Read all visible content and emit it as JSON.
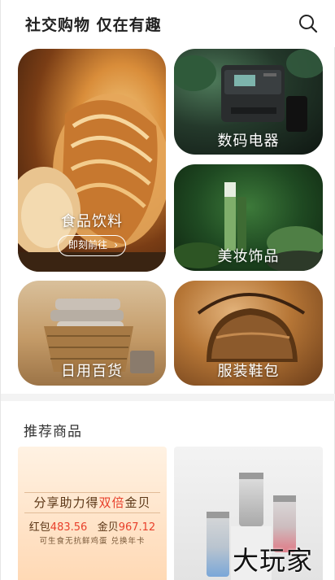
{
  "header": {
    "title": "社交购物 仅在有趣",
    "search_icon": "search-icon"
  },
  "categories": {
    "food": {
      "label": "食品饮料",
      "button": "即刻前往"
    },
    "digital": {
      "label": "数码电器"
    },
    "beauty": {
      "label": "美妆饰品"
    },
    "daily": {
      "label": "日用百货"
    },
    "fashion": {
      "label": "服装鞋包"
    }
  },
  "recommend": {
    "title": "推荐商品",
    "promo": {
      "title_a": "分享助力得",
      "title_hl": "双倍",
      "title_b": "金贝",
      "hongbao_label": "红包",
      "hongbao_value": "483.56",
      "jinbei_label": "金贝",
      "jinbei_value": "967.12",
      "note": "可生食无抗鲜鸡蛋 兑换年卡"
    }
  },
  "watermark": "大玩家",
  "colors": {
    "accent": "#e8402b",
    "text": "#222222"
  }
}
